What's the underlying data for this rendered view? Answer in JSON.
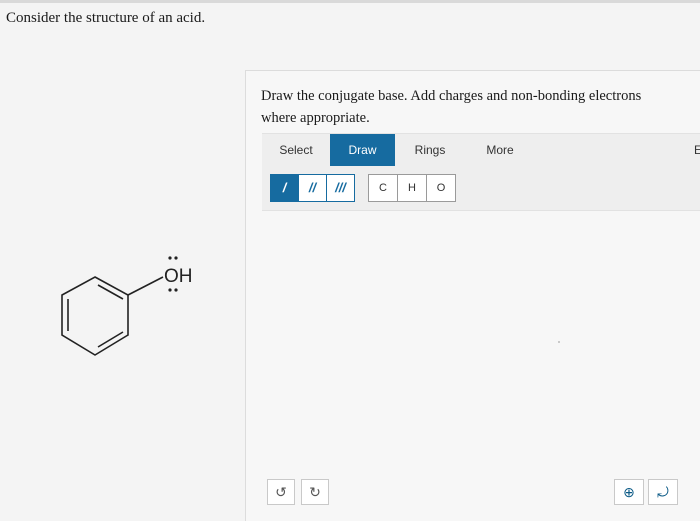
{
  "question": {
    "text": "Consider the structure of an acid."
  },
  "molecule": {
    "group_label": "OH"
  },
  "prompt": {
    "text": "Draw the conjugate base. Add charges and non-bonding electrons where appropriate."
  },
  "tabs": [
    {
      "label": "Select"
    },
    {
      "label": "Draw"
    },
    {
      "label": "Rings"
    },
    {
      "label": "More"
    },
    {
      "label": "Er"
    }
  ],
  "active_tab": "Draw",
  "bond_tools": [
    {
      "label": "/",
      "name": "single-bond"
    },
    {
      "label": "//",
      "name": "double-bond"
    },
    {
      "label": "///",
      "name": "triple-bond"
    }
  ],
  "atom_tools": [
    {
      "label": "C"
    },
    {
      "label": "H"
    },
    {
      "label": "O"
    }
  ],
  "bottom_controls": {
    "undo_icon": "↺",
    "redo_icon": "↻",
    "zoom_icon": "⊕",
    "reset_icon": "⤾"
  },
  "colors": {
    "accent": "#166ba0",
    "background": "#f4f4f4"
  }
}
